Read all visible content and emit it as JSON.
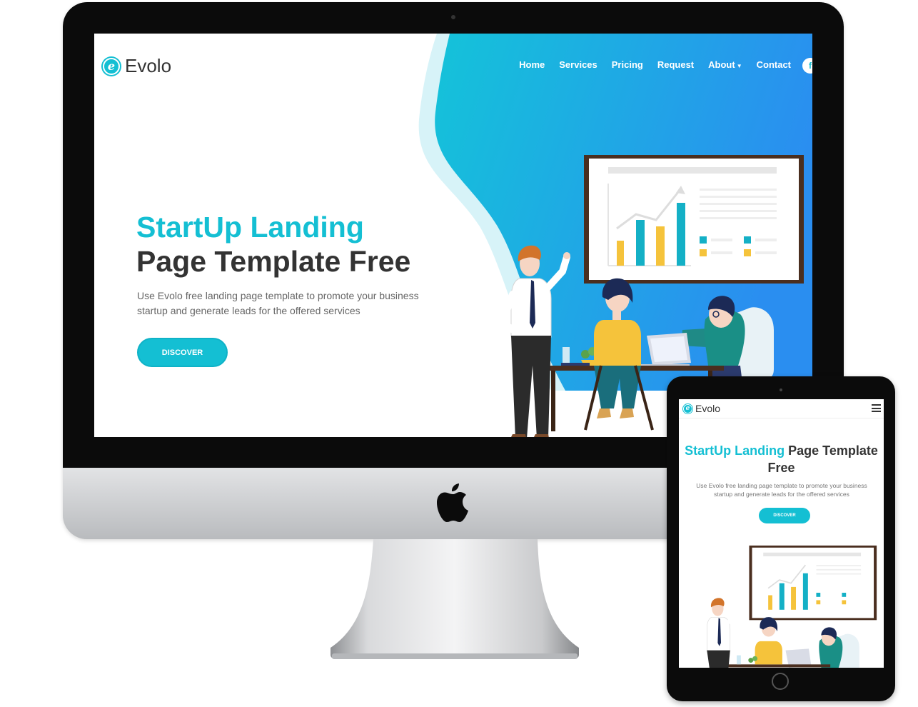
{
  "colors": {
    "accent": "#14bfd3",
    "gradient_start": "#14c3d9",
    "gradient_end": "#2a8ef0",
    "heading_dark": "#333333"
  },
  "desktop": {
    "brand": {
      "mark": "e",
      "name": "Evolo"
    },
    "nav": {
      "home": "Home",
      "services": "Services",
      "pricing": "Pricing",
      "request": "Request",
      "about": "About",
      "contact": "Contact"
    },
    "social_icon": "facebook-icon",
    "hero": {
      "title_line1": "StartUp Landing",
      "title_line2": "Page Template Free",
      "description": "Use Evolo free landing page template to promote your business startup and generate leads for the offered services",
      "button": "DISCOVER"
    }
  },
  "tablet": {
    "brand": {
      "mark": "e",
      "name": "Evolo"
    },
    "menu_icon": "hamburger-icon",
    "hero": {
      "title_accent": "StartUp Landing",
      "title_rest": "Page Template Free",
      "description": "Use Evolo free landing page template to promote your business startup and generate leads for the offered services",
      "button": "DISCOVER"
    }
  }
}
